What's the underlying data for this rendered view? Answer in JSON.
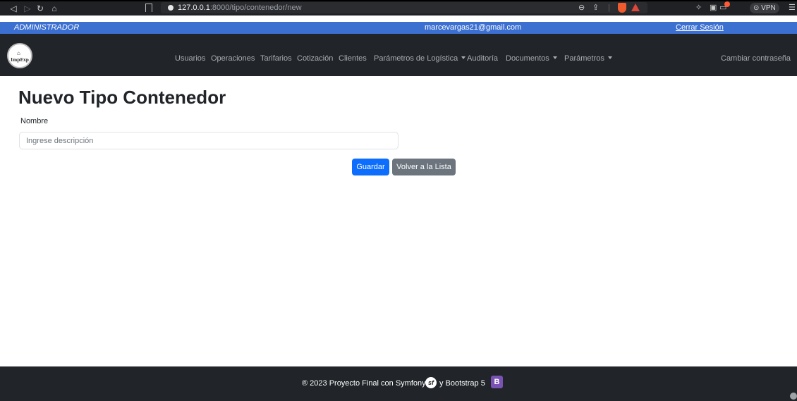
{
  "browser": {
    "url_host": "127.0.0.1",
    "url_path": ":8000/tipo/contenedor/new",
    "vpn_label": "VPN",
    "icons": [
      "back-icon",
      "forward-icon",
      "reload-icon",
      "home-icon",
      "bookmark-icon",
      "zoom-icon",
      "share-icon",
      "brave-shield-icon",
      "brave-rewards-icon",
      "extensions-icon",
      "sidebar-icon",
      "wallet-icon",
      "menu-icon"
    ]
  },
  "info_bar": {
    "role": "ADMINISTRADOR",
    "email": "marcevargas21@gmail.com",
    "logout_label": "Cerrar Sesión"
  },
  "navbar": {
    "logo_text": "ImpExp",
    "items": [
      {
        "label": "Usuarios"
      },
      {
        "label": "Operaciones"
      },
      {
        "label": "Tarifarios"
      },
      {
        "label": "Cotización"
      },
      {
        "label": "Clientes"
      },
      {
        "label": "Parámetros de Logística"
      },
      {
        "label": "Auditoría"
      },
      {
        "label": "Documentos"
      },
      {
        "label": "Parámetros"
      }
    ],
    "change_password_label": "Cambiar contraseña"
  },
  "main": {
    "title": "Nuevo Tipo Contenedor",
    "field_label": "Nombre",
    "field_placeholder": "Ingrese descripción",
    "field_value": "",
    "save_label": "Guardar",
    "back_label": "Volver a la Lista"
  },
  "footer": {
    "text": "® 2023 Proyecto Final con Symfony 6",
    "symfony_logo": "sf",
    "text_2": "y Bootstrap 5",
    "bootstrap_logo": "B"
  },
  "colors": {
    "info_bar_bg": "#3b6fd0",
    "navbar_bg": "#212529",
    "primary": "#0d6efd",
    "secondary": "#6c757d"
  }
}
